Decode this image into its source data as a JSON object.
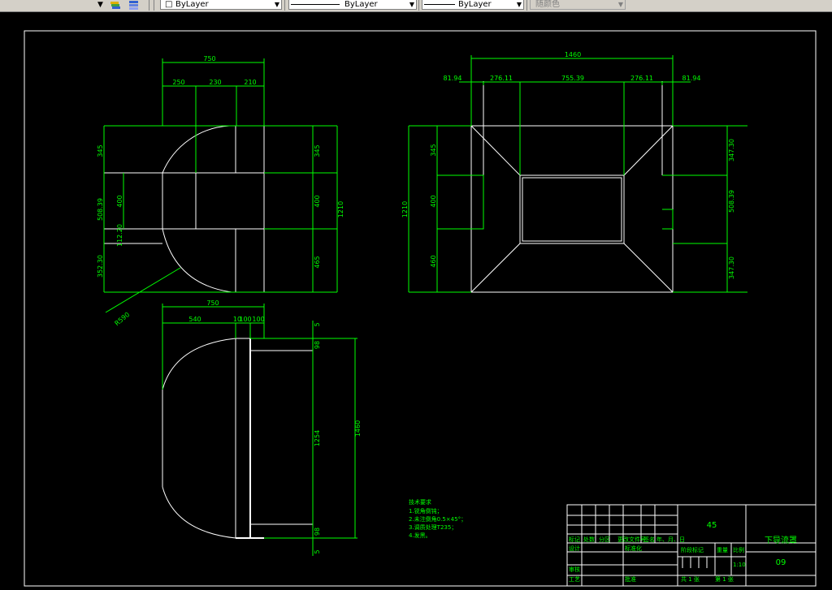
{
  "toolbar": {
    "layer_dropdown_arrow": "▼",
    "color_combo": "ByLayer",
    "linetype_combo": "ByLayer",
    "lineweight_combo": "ByLayer",
    "plotstyle_combo": "随颜色",
    "icons": [
      "layer-previous-icon",
      "layer-stack-icon"
    ]
  },
  "drawing": {
    "view1": {
      "dims": [
        "750",
        "250",
        "230",
        "210",
        "345",
        "400",
        "465",
        "1210",
        "345",
        "508.39",
        "400",
        "112.20",
        "352.30",
        "R590"
      ]
    },
    "view2": {
      "dims": [
        "1460",
        "81.94",
        "276.11",
        "755.39",
        "276.11",
        "81.94",
        "345",
        "400",
        "460",
        "1210",
        "347.30",
        "508.39",
        "347.30"
      ]
    },
    "view3": {
      "dims": [
        "750",
        "540",
        "10",
        "100",
        "100",
        "5",
        "98",
        "1254",
        "1460",
        "98",
        "5"
      ]
    },
    "tech_notes": {
      "title": "技术要求",
      "lines": [
        "1.锐角倒钝；",
        "2.未注倒角0.5×45°；",
        "3.调质处理T235；",
        "4.发黑。"
      ]
    },
    "title_block": {
      "material": "45",
      "part_name": "下导流罩",
      "drawing_no": "09",
      "scale_label": "比例",
      "scale": "1:10",
      "weight_label": "重量",
      "stage_label": "阶段标记",
      "header_row": [
        "标记",
        "处数",
        "分区",
        "更改文件号",
        "签名",
        "年、月、日"
      ],
      "designer_label": "设计",
      "standardize_label": "标准化",
      "review_label": "审核",
      "process_label": "工艺",
      "approve_label": "批准",
      "sheets_text": "共 1 张",
      "sheet_text": "第 1 张"
    }
  },
  "colors": {
    "background": "#000000",
    "geometry": "#ffffff",
    "dimension": "#00ff00",
    "toolbar": "#d4d0c8"
  }
}
